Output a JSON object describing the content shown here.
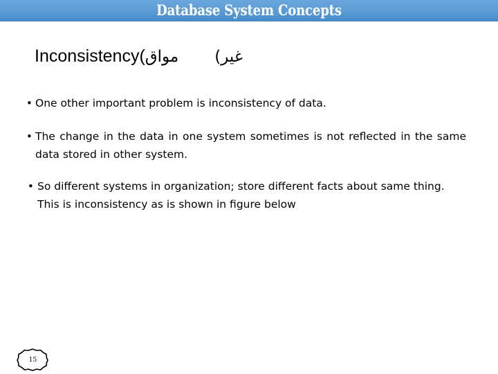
{
  "slide": {
    "header": {
      "title": "Database System Concepts",
      "background_top": "#6aa6dd",
      "background_bottom": "#3f88c8",
      "text_color": "#ffffff"
    },
    "subtitle": {
      "english": "Inconsistency(",
      "urdu_left": "مواق",
      "urdu_right": "غیر)"
    },
    "bullets": [
      {
        "marker": "•",
        "text": "One other important problem is inconsistency of data."
      },
      {
        "marker": "•",
        "text": "The change in the data in one system sometimes is not reflected in the same data stored in other system."
      },
      {
        "marker": "•",
        "text": "So different systems in organization; store different facts about same thing. This is inconsistency as is shown in figure below"
      }
    ],
    "page_number": "15"
  }
}
